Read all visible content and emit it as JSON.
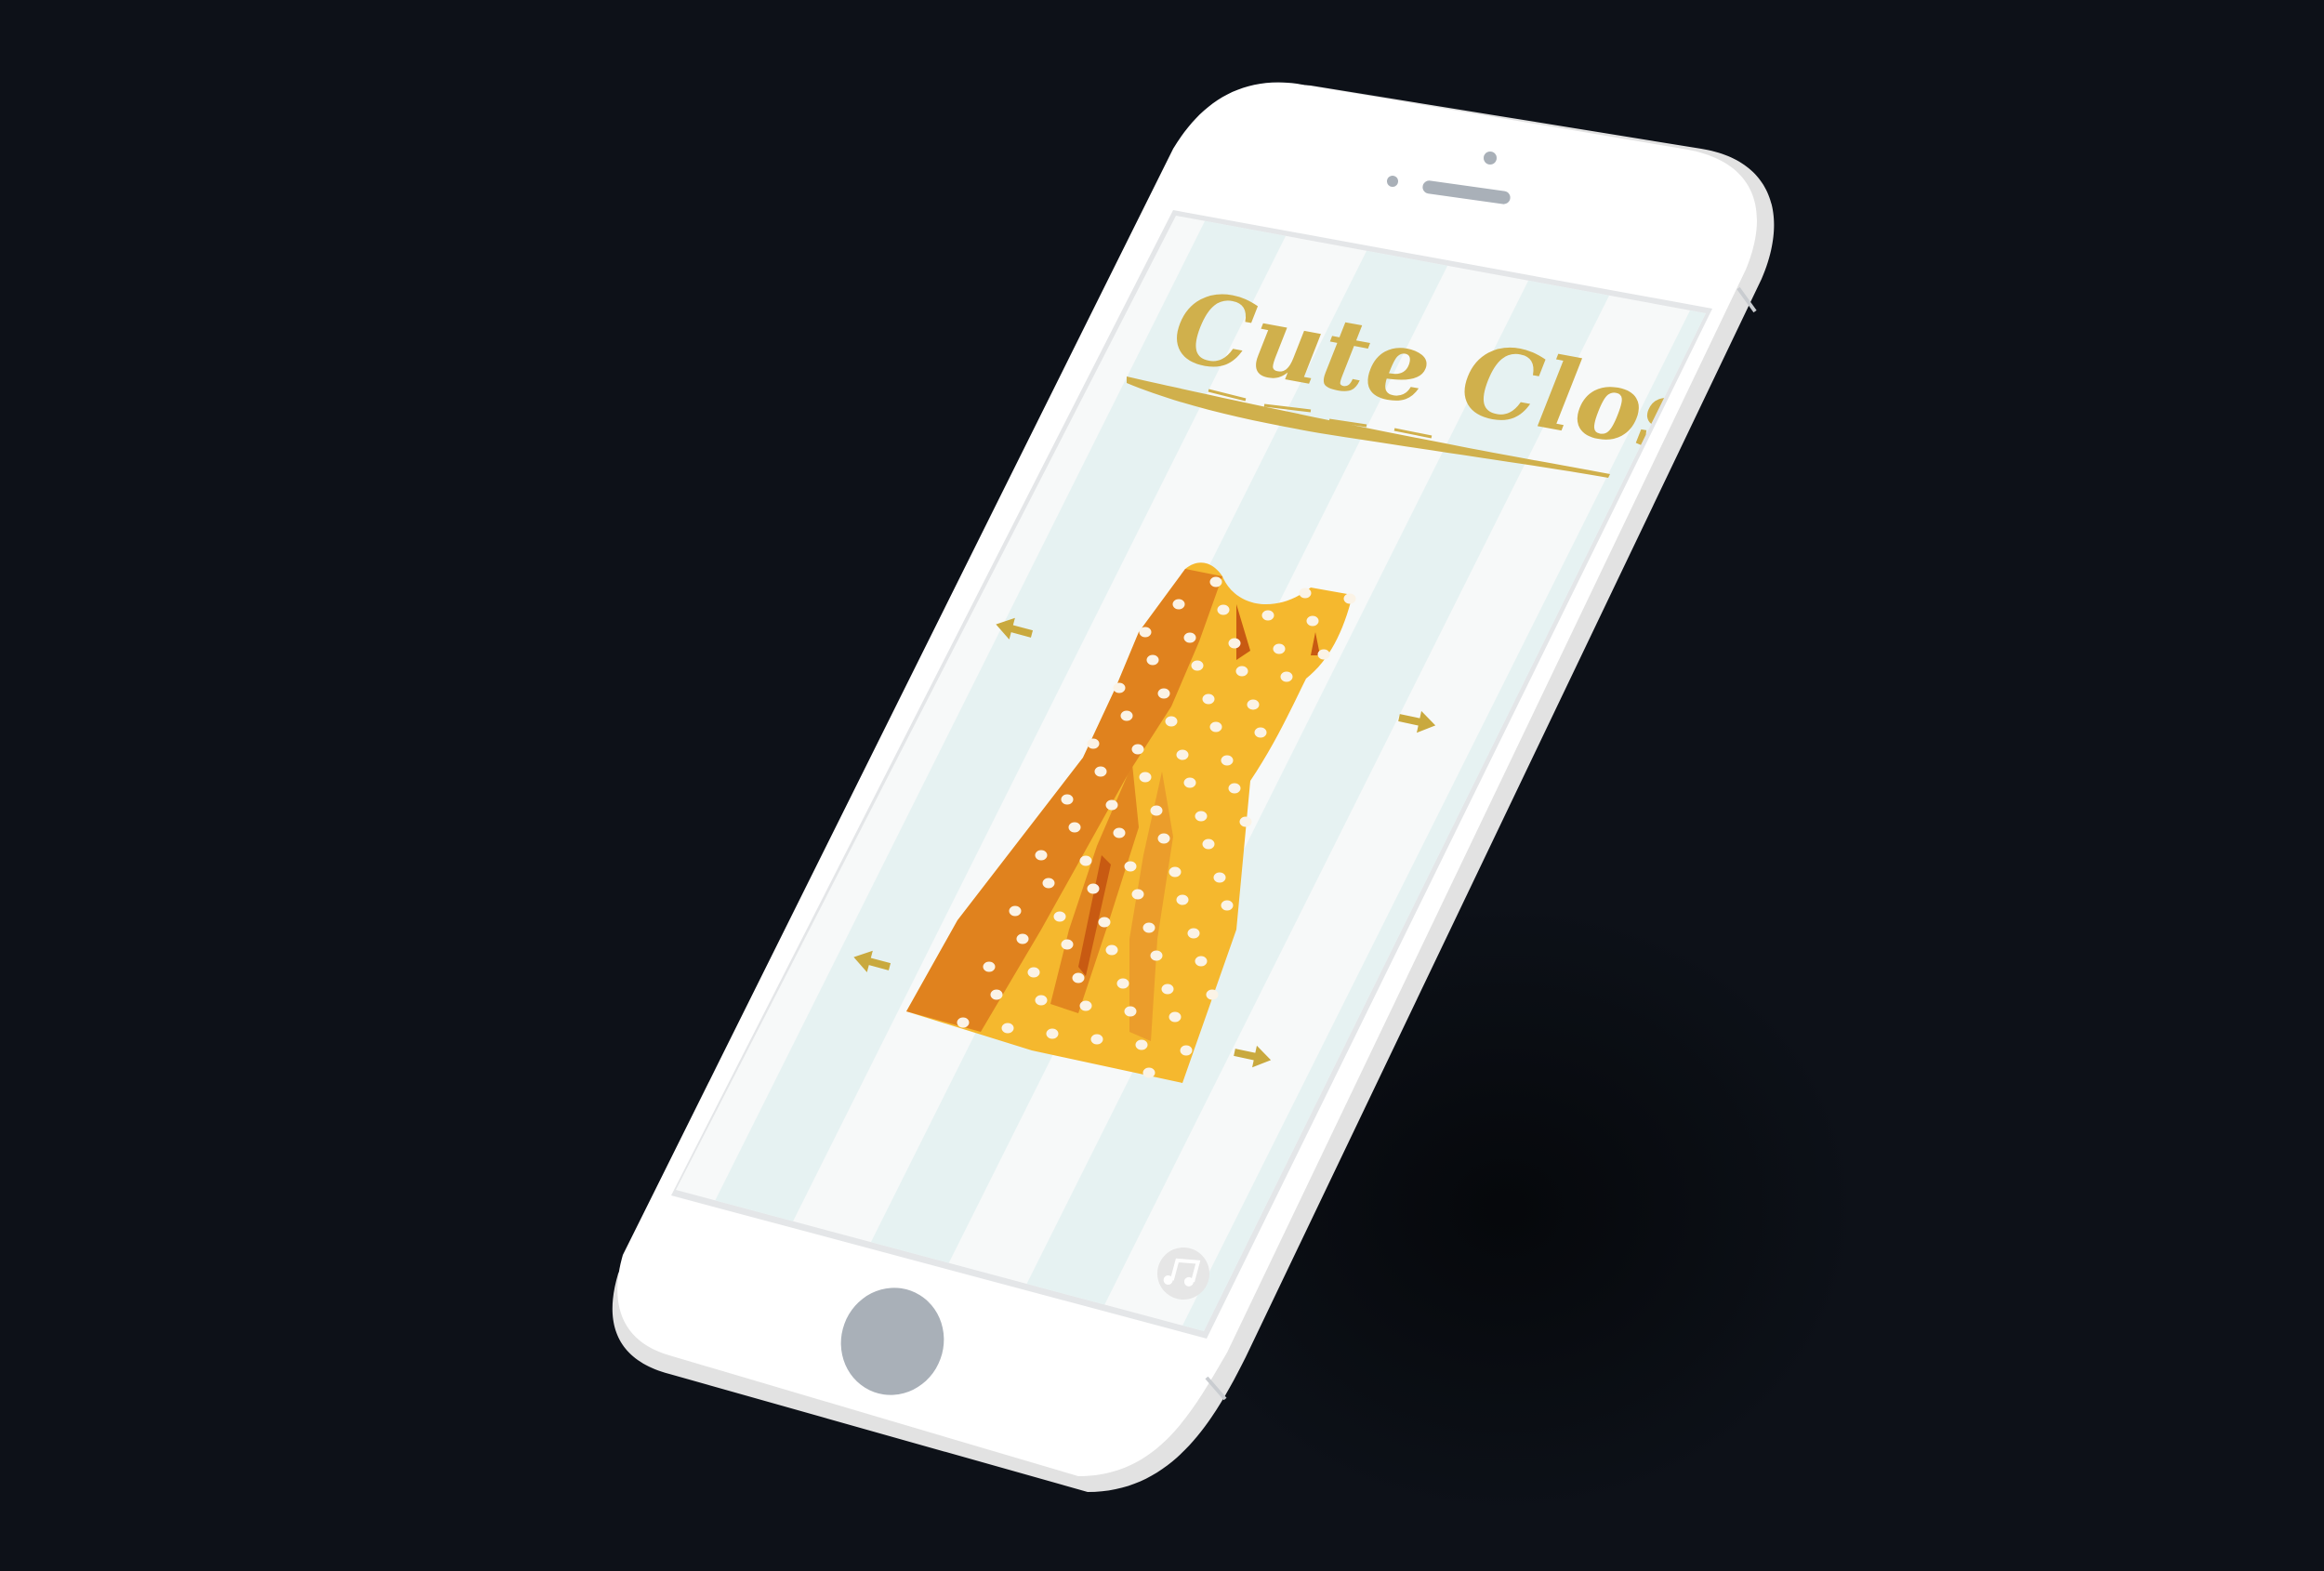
{
  "app": {
    "title": "Cute Closet"
  },
  "screen": {
    "stripe_colors": [
      "#f7f9f9",
      "#e6f2f2"
    ],
    "title_color": "#d0b04c"
  },
  "dress": {
    "base_color": "#f5b82e",
    "shadow_color": "#e0821e",
    "dot_color": "#fbf3e6"
  },
  "controls": {
    "arrow_color": "#c9a93e",
    "music_icon": "music-note-icon"
  },
  "device": {
    "body_color": "#ffffff",
    "edge_color": "#e2e2e2",
    "home_button_color": "#a9b0b8",
    "speaker_color": "#a9b0b8"
  }
}
